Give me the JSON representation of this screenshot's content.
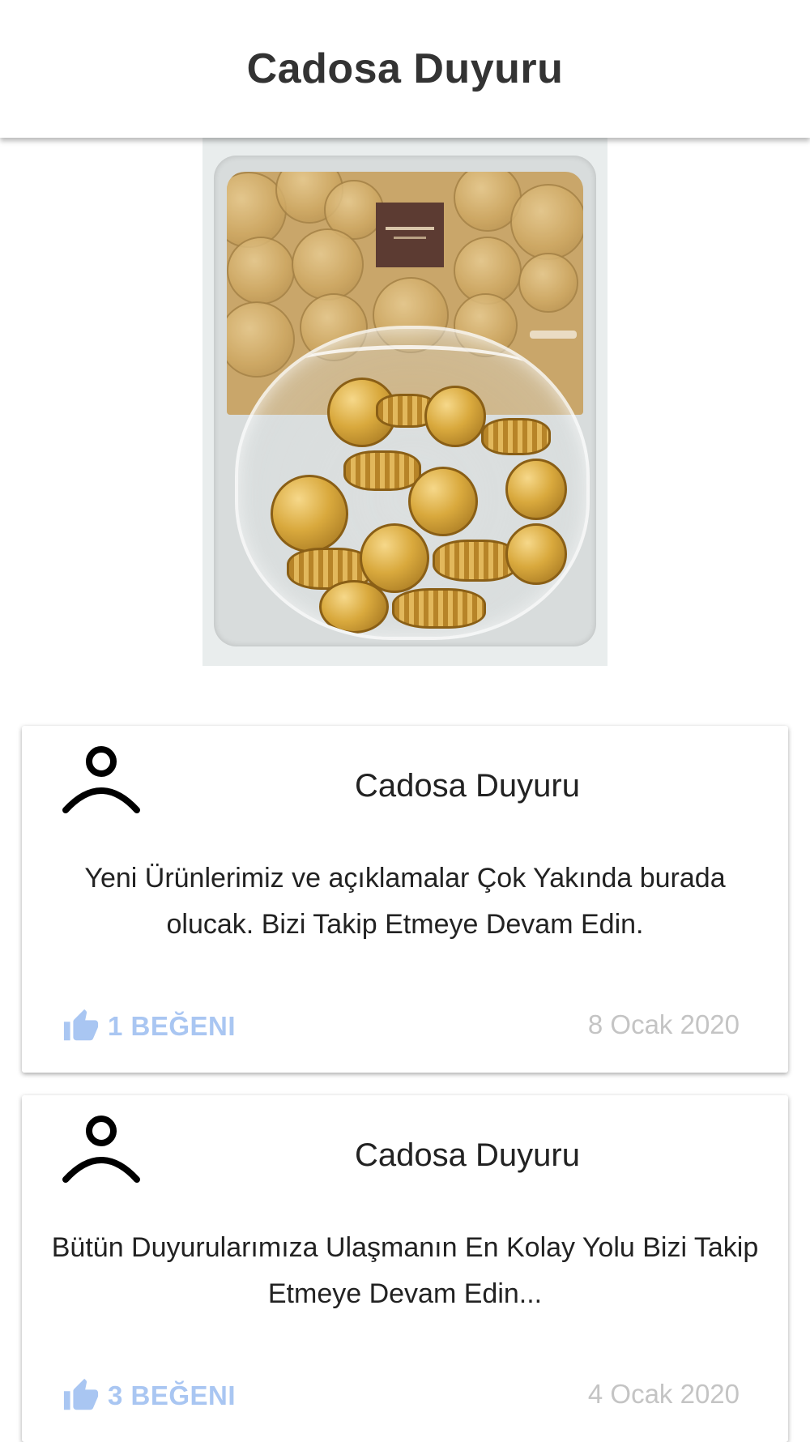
{
  "app_bar": {
    "title": "Cadosa Duyuru"
  },
  "hero_image": {
    "alt": "Cadosa product image",
    "icon": "product-photo"
  },
  "posts": [
    {
      "author": "Cadosa Duyuru",
      "body": "Yeni Ürünlerimiz ve açıklamalar Çok Yakında burada olucak. Bizi Takip Etmeye Devam Edin.",
      "likes_label": "1 BEĞENI",
      "date": "8 Ocak 2020"
    },
    {
      "author": "Cadosa Duyuru",
      "body": "Bütün Duyurularımıza Ulaşmanın En Kolay Yolu Bizi Takip Etmeye Devam Edin...",
      "likes_label": "3 BEĞENI",
      "date": "4 Ocak 2020"
    }
  ],
  "colors": {
    "accent_like": "#a9c6f2",
    "date_gray": "#c4c4c4",
    "title_dark": "#333333"
  },
  "icons": {
    "avatar": "person-outline-icon",
    "like": "thumb-up-icon"
  }
}
